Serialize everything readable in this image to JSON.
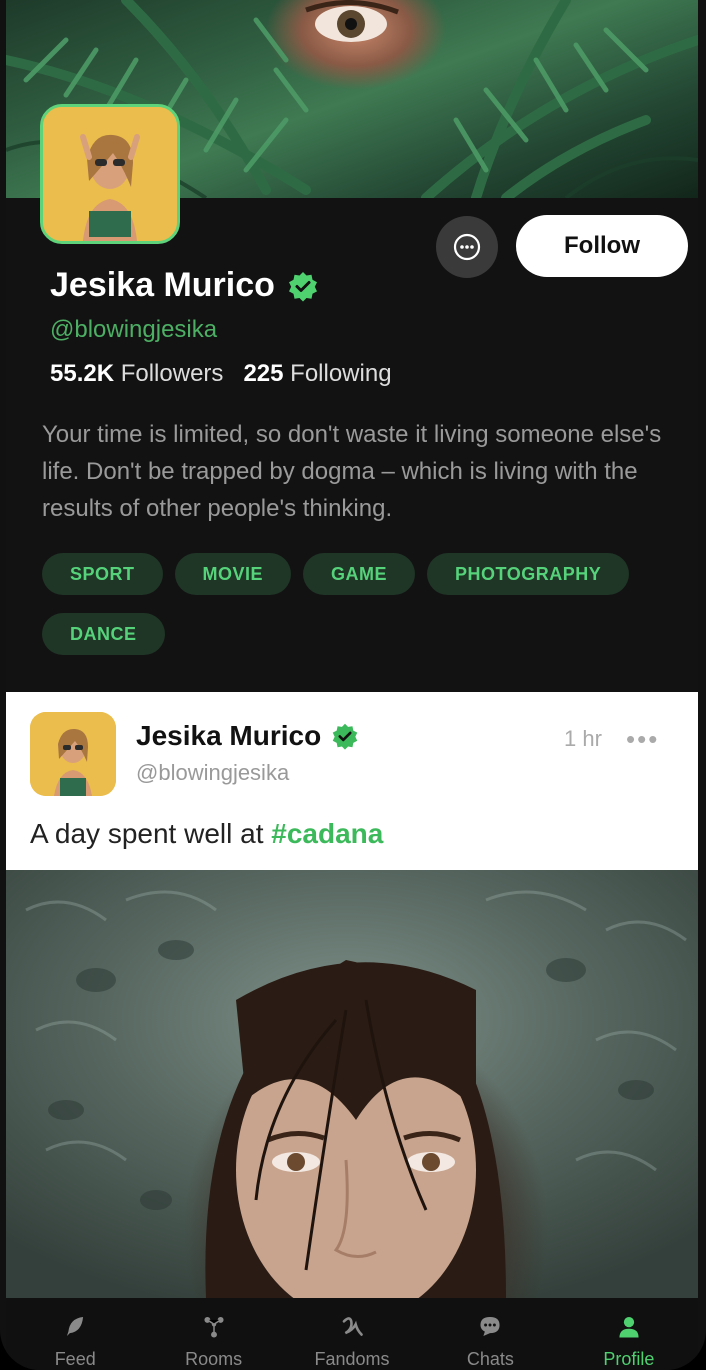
{
  "profile": {
    "name": "Jesika Murico",
    "handle": "@blowingjesika",
    "followers_count": "55.2K",
    "followers_label": "Followers",
    "following_count": "225",
    "following_label": "Following",
    "bio": "Your time is limited, so don't waste it living someone else's life. Don't be trapped by dogma – which is living with the results of other people's thinking.",
    "follow_label": "Follow",
    "tags": [
      "SPORT",
      "MOVIE",
      "GAME",
      "PHOTOGRAPHY",
      "DANCE"
    ]
  },
  "post": {
    "author": "Jesika Murico",
    "handle": "@blowingjesika",
    "time": "1 hr",
    "more": "•••",
    "text": "A day spent well at ",
    "hashtag": "#cadana"
  },
  "nav": {
    "items": [
      {
        "label": "Feed",
        "icon": "feather-icon"
      },
      {
        "label": "Rooms",
        "icon": "rooms-icon"
      },
      {
        "label": "Fandoms",
        "icon": "fandoms-icon"
      },
      {
        "label": "Chats",
        "icon": "chat-icon"
      },
      {
        "label": "Profile",
        "icon": "user-icon"
      }
    ],
    "active_index": 4
  },
  "colors": {
    "accent": "#4fd170",
    "tag_bg": "#1f3526",
    "background": "#121212"
  }
}
